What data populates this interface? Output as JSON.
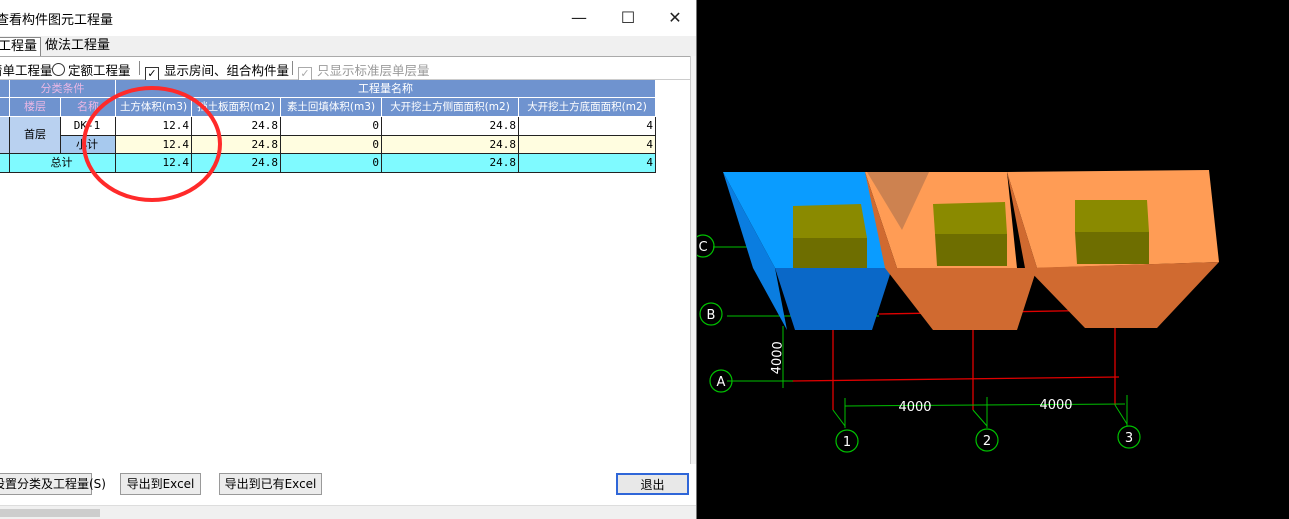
{
  "window": {
    "title": "查看构件图元工程量",
    "minimize_glyph": "—",
    "maximize_glyph": "☐",
    "close_glyph": "✕"
  },
  "tabs": [
    {
      "label": "工程量"
    },
    {
      "label": "做法工程量"
    }
  ],
  "options": {
    "radio_list": "清单工程量",
    "radio_quota": "定额工程量",
    "check_room": "显示房间、组合构件量",
    "check_room_checked": true,
    "check_std": "只显示标准层单层量",
    "check_std_checked": true
  },
  "table": {
    "group_header_left": "分类条件",
    "group_header_right": "工程量名称",
    "col_floor": "楼层",
    "col_name": "名称",
    "qty_headers": [
      "土方体积(m3)",
      "挡土板面积(m2)",
      "素土回填体积(m3)",
      "大开挖土方侧面面积(m2)",
      "大开挖土方底面面积(m2)"
    ],
    "floor": "首层",
    "rows": [
      {
        "name": "DK-1",
        "values": [
          "12.4",
          "24.8",
          "0",
          "24.8",
          "4"
        ]
      },
      {
        "name": "小计",
        "values": [
          "12.4",
          "24.8",
          "0",
          "24.8",
          "4"
        ]
      }
    ],
    "total": {
      "label": "总计",
      "values": [
        "12.4",
        "24.8",
        "0",
        "24.8",
        "4"
      ]
    }
  },
  "buttons": {
    "set_category": "设置分类及工程量(S)",
    "export_excel": "导出到Excel",
    "export_existing": "导出到已有Excel",
    "exit": "退出"
  },
  "cad": {
    "axis_c": "C",
    "axis_b": "B",
    "axis_a": "A",
    "axis_1": "1",
    "axis_2": "2",
    "axis_3": "3",
    "dim_vertical": "4000",
    "dim_1": "4000",
    "dim_2": "4000",
    "colors": {
      "blue_pit": "#0a9cff",
      "orange_pit": "#ff9c55",
      "foundation": "#808000",
      "grid_red": "#e00000",
      "grid_green": "#00c000"
    }
  }
}
